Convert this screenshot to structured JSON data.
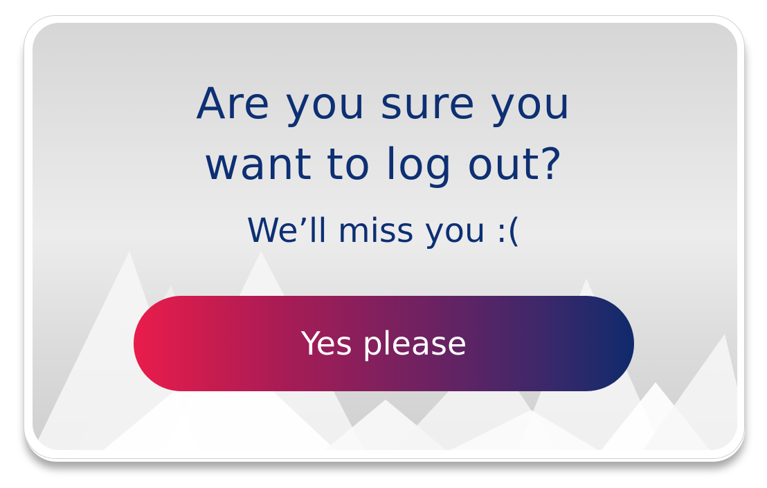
{
  "dialog": {
    "title_line1": "Are you sure you",
    "title_line2": "want to log out?",
    "subtitle": "We’ll miss you :(",
    "confirm_label": "Yes please"
  },
  "colors": {
    "text": "#0d2f73",
    "button_gradient_start": "#e91c4b",
    "button_gradient_end": "#0f2a6b",
    "button_text": "#ffffff"
  },
  "icons": {
    "background": "mountains-decoration"
  }
}
